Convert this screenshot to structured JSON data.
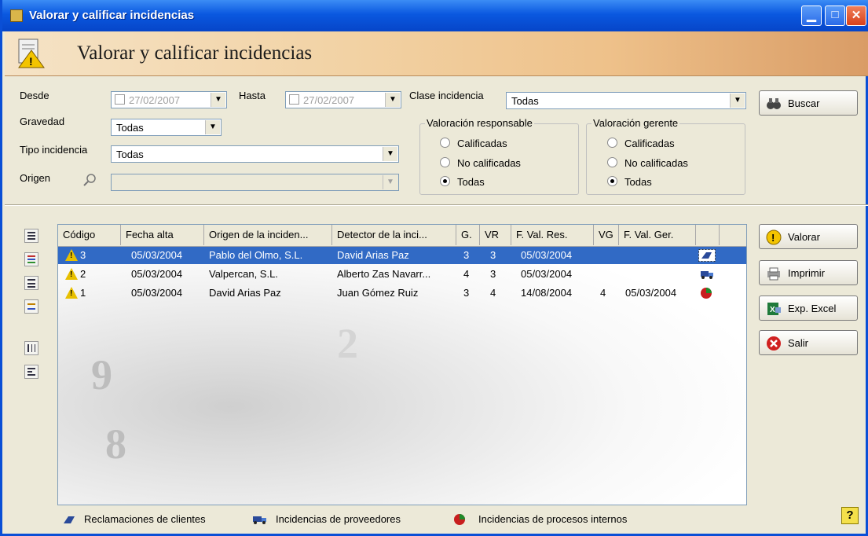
{
  "window": {
    "title": "Valorar y calificar incidencias",
    "min_glyph": "▁",
    "max_glyph": "□",
    "close_glyph": "✕"
  },
  "banner": {
    "title": "Valorar y calificar incidencias",
    "icon": "warning-document-icon"
  },
  "filters": {
    "desde_label": "Desde",
    "desde_value": "27/02/2007",
    "hasta_label": "Hasta",
    "hasta_value": "27/02/2007",
    "clase_label": "Clase incidencia",
    "clase_value": "Todas",
    "gravedad_label": "Gravedad",
    "gravedad_value": "Todas",
    "tipo_label": "Tipo incidencia",
    "tipo_value": "Todas",
    "origen_label": "Origen",
    "origen_value": ""
  },
  "valoracion_responsable": {
    "title": "Valoración responsable",
    "options": [
      "Calificadas",
      "No calificadas",
      "Todas"
    ],
    "selected": "Todas"
  },
  "valoracion_gerente": {
    "title": "Valoración gerente",
    "options": [
      "Calificadas",
      "No calificadas",
      "Todas"
    ],
    "selected": "Todas"
  },
  "buttons": {
    "buscar": "Buscar",
    "valorar": "Valorar",
    "imprimir": "Imprimir",
    "exp_excel": "Exp. Excel",
    "salir": "Salir",
    "help": "?"
  },
  "table": {
    "columns": [
      "Código",
      "Fecha alta",
      "Origen de la inciden...",
      "Detector de la inci...",
      "G.",
      "VR",
      "F. Val. Res.",
      "VG",
      "F. Val. Ger."
    ],
    "rows": [
      {
        "codigo": "3",
        "fecha": "05/03/2004",
        "origen": "Pablo del Olmo, S.L.",
        "detector": "David Arias Paz",
        "g": "3",
        "vr": "3",
        "fvalres": "05/03/2004",
        "vg": "",
        "fvalger": "",
        "type_icon": "customer-claim-icon",
        "selected": true
      },
      {
        "codigo": "2",
        "fecha": "05/03/2004",
        "origen": "Valpercan, S.L.",
        "detector": "Alberto Zas Navarr...",
        "g": "4",
        "vr": "3",
        "fvalres": "05/03/2004",
        "vg": "",
        "fvalger": "",
        "type_icon": "supplier-incident-icon",
        "selected": false
      },
      {
        "codigo": "1",
        "fecha": "05/03/2004",
        "origen": "David Arias Paz",
        "detector": "Juan Gómez Ruiz",
        "g": "3",
        "vr": "4",
        "fvalres": "14/08/2004",
        "vg": "4",
        "fvalger": "05/03/2004",
        "type_icon": "internal-process-icon",
        "selected": false
      }
    ]
  },
  "legend": {
    "clientes": "Reclamaciones de clientes",
    "proveedores": "Incidencias de proveedores",
    "procesos": "Incidencias de procesos internos"
  },
  "colors": {
    "selection": "#316ac5",
    "titlebar": "#0a58e0",
    "accent": "#e8c000"
  }
}
